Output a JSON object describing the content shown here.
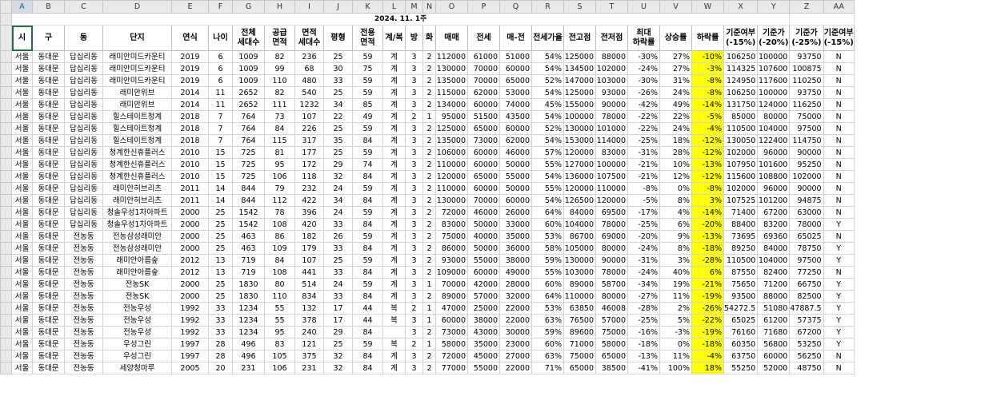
{
  "app": {
    "title": "Spreadsheet"
  },
  "sheet": {
    "date_label": "2024. 11. 1주",
    "column_letters": [
      "A",
      "B",
      "C",
      "D",
      "E",
      "F",
      "G",
      "H",
      "I",
      "J",
      "K",
      "L",
      "M",
      "N",
      "O",
      "P",
      "Q",
      "R",
      "S",
      "T",
      "U",
      "V",
      "W",
      "X",
      "Y",
      "Z",
      "AA"
    ],
    "headers": [
      "시",
      "구",
      "동",
      "단지",
      "연식",
      "나이",
      "전체\n세대수",
      "공급\n면적",
      "면적\n세대수",
      "평형",
      "전용\n면적",
      "계/복",
      "방",
      "화",
      "매매",
      "전세",
      "매-전",
      "전세가율",
      "전고점",
      "전저점",
      "최대\n하락률",
      "상승률",
      "하락률",
      "기준여부\n(-15%)",
      "기준가\n(-20%)",
      "기준가\n(-25%)",
      "기준여부\n(-15%)"
    ],
    "highlight_color": "#ffff00",
    "rows": [
      [
        "서울",
        "동대문",
        "답십리동",
        "래미안미드카운티",
        "2019",
        "6",
        "1009",
        "82",
        "236",
        "25",
        "59",
        "계",
        "3",
        "2",
        "112000",
        "61000",
        "51000",
        "54%",
        "125000",
        "88000",
        "-30%",
        "27%",
        "-10%",
        "106250",
        "100000",
        "93750",
        "N"
      ],
      [
        "서울",
        "동대문",
        "답십리동",
        "래미안미드카운티",
        "2019",
        "6",
        "1009",
        "99",
        "68",
        "30",
        "75",
        "계",
        "3",
        "2",
        "130000",
        "70000",
        "60000",
        "54%",
        "134500",
        "102000",
        "-24%",
        "27%",
        "-3%",
        "114325",
        "107600",
        "100875",
        "N"
      ],
      [
        "서울",
        "동대문",
        "답십리동",
        "래미안미드카운티",
        "2019",
        "6",
        "1009",
        "110",
        "480",
        "33",
        "59",
        "계",
        "3",
        "2",
        "135000",
        "70000",
        "65000",
        "52%",
        "147000",
        "103000",
        "-30%",
        "31%",
        "-8%",
        "124950",
        "117600",
        "110250",
        "N"
      ],
      [
        "서울",
        "동대문",
        "답십리동",
        "래미안위브",
        "2014",
        "11",
        "2652",
        "82",
        "540",
        "25",
        "59",
        "계",
        "3",
        "2",
        "115000",
        "62000",
        "53000",
        "54%",
        "125000",
        "93000",
        "-26%",
        "24%",
        "-8%",
        "106250",
        "100000",
        "93750",
        "N"
      ],
      [
        "서울",
        "동대문",
        "답십리동",
        "래미안위브",
        "2014",
        "11",
        "2652",
        "111",
        "1232",
        "34",
        "85",
        "계",
        "3",
        "2",
        "134000",
        "60000",
        "74000",
        "45%",
        "155000",
        "90000",
        "-42%",
        "49%",
        "-14%",
        "131750",
        "124000",
        "116250",
        "N"
      ],
      [
        "서울",
        "동대문",
        "답십리동",
        "힐스테이트청계",
        "2018",
        "7",
        "764",
        "73",
        "107",
        "22",
        "49",
        "계",
        "2",
        "1",
        "95000",
        "51500",
        "43500",
        "54%",
        "100000",
        "78000",
        "-22%",
        "22%",
        "-5%",
        "85000",
        "80000",
        "75000",
        "N"
      ],
      [
        "서울",
        "동대문",
        "답십리동",
        "힐스테이트청계",
        "2018",
        "7",
        "764",
        "84",
        "226",
        "25",
        "59",
        "계",
        "3",
        "2",
        "125000",
        "65000",
        "60000",
        "52%",
        "130000",
        "101000",
        "-22%",
        "24%",
        "-4%",
        "110500",
        "104000",
        "97500",
        "N"
      ],
      [
        "서울",
        "동대문",
        "답십리동",
        "힐스테이트청계",
        "2018",
        "7",
        "764",
        "115",
        "317",
        "35",
        "84",
        "계",
        "3",
        "2",
        "135000",
        "73000",
        "62000",
        "54%",
        "153000",
        "114000",
        "-25%",
        "18%",
        "-12%",
        "130050",
        "122400",
        "114750",
        "N"
      ],
      [
        "서울",
        "동대문",
        "답십리동",
        "청계한신휴플러스",
        "2010",
        "15",
        "725",
        "81",
        "177",
        "25",
        "59",
        "계",
        "3",
        "2",
        "106000",
        "60000",
        "46000",
        "57%",
        "120000",
        "83000",
        "-31%",
        "28%",
        "-12%",
        "102000",
        "96000",
        "90000",
        "N"
      ],
      [
        "서울",
        "동대문",
        "답십리동",
        "청계한신휴플러스",
        "2010",
        "15",
        "725",
        "95",
        "172",
        "29",
        "74",
        "계",
        "3",
        "2",
        "110000",
        "60000",
        "50000",
        "55%",
        "127000",
        "100000",
        "-21%",
        "10%",
        "-13%",
        "107950",
        "101600",
        "95250",
        "N"
      ],
      [
        "서울",
        "동대문",
        "답십리동",
        "청계한신휴플러스",
        "2010",
        "15",
        "725",
        "106",
        "118",
        "32",
        "84",
        "계",
        "3",
        "2",
        "120000",
        "65000",
        "55000",
        "54%",
        "136000",
        "107500",
        "-21%",
        "12%",
        "-12%",
        "115600",
        "108800",
        "102000",
        "N"
      ],
      [
        "서울",
        "동대문",
        "답십리동",
        "래미안허브리츠",
        "2011",
        "14",
        "844",
        "79",
        "232",
        "24",
        "59",
        "계",
        "3",
        "2",
        "110000",
        "60000",
        "50000",
        "55%",
        "120000",
        "110000",
        "-8%",
        "0%",
        "-8%",
        "102000",
        "96000",
        "90000",
        "N"
      ],
      [
        "서울",
        "동대문",
        "답십리동",
        "래미안허브리츠",
        "2011",
        "14",
        "844",
        "112",
        "422",
        "34",
        "84",
        "계",
        "3",
        "2",
        "130000",
        "70000",
        "60000",
        "54%",
        "126500",
        "120000",
        "-5%",
        "8%",
        "3%",
        "107525",
        "101200",
        "94875",
        "N"
      ],
      [
        "서울",
        "동대문",
        "답십리동",
        "청솔우성1차아파트",
        "2000",
        "25",
        "1542",
        "78",
        "396",
        "24",
        "59",
        "계",
        "3",
        "2",
        "72000",
        "46000",
        "26000",
        "64%",
        "84000",
        "69500",
        "-17%",
        "4%",
        "-14%",
        "71400",
        "67200",
        "63000",
        "N"
      ],
      [
        "서울",
        "동대문",
        "답십리동",
        "청솔우성1차아파트",
        "2000",
        "25",
        "1542",
        "108",
        "420",
        "33",
        "84",
        "계",
        "3",
        "2",
        "83000",
        "50000",
        "33000",
        "60%",
        "104000",
        "78000",
        "-25%",
        "6%",
        "-20%",
        "88400",
        "83200",
        "78000",
        "Y"
      ],
      [
        "서울",
        "동대문",
        "전농동",
        "전농삼성래미안",
        "2000",
        "25",
        "463",
        "86",
        "182",
        "26",
        "59",
        "계",
        "3",
        "2",
        "75000",
        "40000",
        "35000",
        "53%",
        "86700",
        "69000",
        "-20%",
        "9%",
        "-13%",
        "73695",
        "69360",
        "65025",
        "N"
      ],
      [
        "서울",
        "동대문",
        "전농동",
        "전농삼성래미안",
        "2000",
        "25",
        "463",
        "109",
        "179",
        "33",
        "84",
        "계",
        "3",
        "2",
        "86000",
        "50000",
        "36000",
        "58%",
        "105000",
        "80000",
        "-24%",
        "8%",
        "-18%",
        "89250",
        "84000",
        "78750",
        "Y"
      ],
      [
        "서울",
        "동대문",
        "전농동",
        "래미안아름숲",
        "2012",
        "13",
        "719",
        "84",
        "107",
        "25",
        "59",
        "계",
        "3",
        "2",
        "93000",
        "55000",
        "38000",
        "59%",
        "130000",
        "90000",
        "-31%",
        "3%",
        "-28%",
        "110500",
        "104000",
        "97500",
        "Y"
      ],
      [
        "서울",
        "동대문",
        "전농동",
        "래미안아름숲",
        "2012",
        "13",
        "719",
        "108",
        "441",
        "33",
        "84",
        "계",
        "3",
        "2",
        "109000",
        "60000",
        "49000",
        "55%",
        "103000",
        "78000",
        "-24%",
        "40%",
        "6%",
        "87550",
        "82400",
        "77250",
        "N"
      ],
      [
        "서울",
        "동대문",
        "전농동",
        "전농SK",
        "2000",
        "25",
        "1830",
        "80",
        "514",
        "24",
        "59",
        "계",
        "3",
        "1",
        "70000",
        "42000",
        "28000",
        "60%",
        "89000",
        "58700",
        "-34%",
        "19%",
        "-21%",
        "75650",
        "71200",
        "66750",
        "Y"
      ],
      [
        "서울",
        "동대문",
        "전농동",
        "전농SK",
        "2000",
        "25",
        "1830",
        "110",
        "834",
        "33",
        "84",
        "계",
        "3",
        "2",
        "89000",
        "57000",
        "32000",
        "64%",
        "110000",
        "80000",
        "-27%",
        "11%",
        "-19%",
        "93500",
        "88000",
        "82500",
        "Y"
      ],
      [
        "서울",
        "동대문",
        "전농동",
        "전농우성",
        "1992",
        "33",
        "1234",
        "55",
        "132",
        "17",
        "44",
        "복",
        "2",
        "1",
        "47000",
        "25000",
        "22000",
        "53%",
        "63850",
        "46008",
        "-28%",
        "2%",
        "-26%",
        "54272.5",
        "51080",
        "47887.5",
        "Y"
      ],
      [
        "서울",
        "동대문",
        "전농동",
        "전농우성",
        "1992",
        "33",
        "1234",
        "55",
        "378",
        "17",
        "44",
        "복",
        "3",
        "1",
        "60000",
        "38000",
        "22000",
        "63%",
        "76500",
        "57000",
        "-25%",
        "5%",
        "-22%",
        "65025",
        "61200",
        "57375",
        "Y"
      ],
      [
        "서울",
        "동대문",
        "전농동",
        "전농우성",
        "1992",
        "33",
        "1234",
        "95",
        "240",
        "29",
        "84",
        "",
        "3",
        "2",
        "73000",
        "43000",
        "30000",
        "59%",
        "89600",
        "75000",
        "-16%",
        "-3%",
        "-19%",
        "76160",
        "71680",
        "67200",
        "Y"
      ],
      [
        "서울",
        "동대문",
        "전농동",
        "우성그린",
        "1997",
        "28",
        "496",
        "83",
        "121",
        "25",
        "59",
        "복",
        "2",
        "1",
        "58000",
        "35000",
        "23000",
        "60%",
        "71000",
        "58000",
        "-18%",
        "0%",
        "-18%",
        "60350",
        "56800",
        "53250",
        "Y"
      ],
      [
        "서울",
        "동대문",
        "전농동",
        "우성그린",
        "1997",
        "28",
        "496",
        "105",
        "375",
        "32",
        "84",
        "계",
        "3",
        "2",
        "72000",
        "45000",
        "27000",
        "63%",
        "75000",
        "65000",
        "-13%",
        "11%",
        "-4%",
        "63750",
        "60000",
        "56250",
        "N"
      ],
      [
        "서울",
        "동대문",
        "전농동",
        "세양청마루",
        "2005",
        "20",
        "231",
        "106",
        "231",
        "32",
        "84",
        "계",
        "3",
        "2",
        "77000",
        "55000",
        "22000",
        "71%",
        "65000",
        "38500",
        "-41%",
        "100%",
        "18%",
        "55250",
        "52000",
        "48750",
        "N"
      ]
    ]
  }
}
